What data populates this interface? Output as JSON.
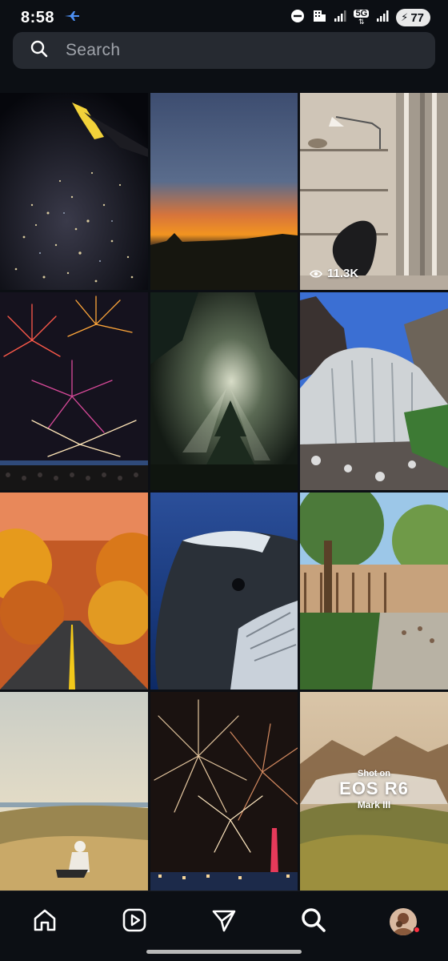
{
  "status_bar": {
    "time": "8:58",
    "network": "5G",
    "battery": "77"
  },
  "search": {
    "placeholder": "Search"
  },
  "grid": {
    "tiles": [
      {
        "subject": "city lights from airplane window at night",
        "overlay": ""
      },
      {
        "subject": "orange sunset sky",
        "overlay": ""
      },
      {
        "subject": "interior with egg chair and shelves",
        "overlay": "11.3K"
      },
      {
        "subject": "fireworks over crowd",
        "overlay": ""
      },
      {
        "subject": "sunbeams through forest",
        "overlay": ""
      },
      {
        "subject": "waterfall over rocks",
        "overlay": ""
      },
      {
        "subject": "autumn road through orange trees",
        "overlay": ""
      },
      {
        "subject": "humpback whale underwater",
        "overlay": ""
      },
      {
        "subject": "tree-lined walkway with people",
        "overlay": ""
      },
      {
        "subject": "person sitting on coastal hill",
        "overlay": ""
      },
      {
        "subject": "fireworks over city tower",
        "overlay": ""
      },
      {
        "subject": "misty mountains advertisement",
        "overlay": ""
      }
    ],
    "ad_text": {
      "line1": "Shot on",
      "line2": "EOS R6",
      "line3": "Mark III"
    }
  },
  "nav": {
    "items": [
      "home-icon",
      "reels-icon",
      "send-icon",
      "search-icon",
      "profile-avatar"
    ],
    "active": "search-icon"
  },
  "colors": {
    "background": "#0c0f14",
    "search_bg": "#262a31",
    "notification": "#ff3040"
  }
}
